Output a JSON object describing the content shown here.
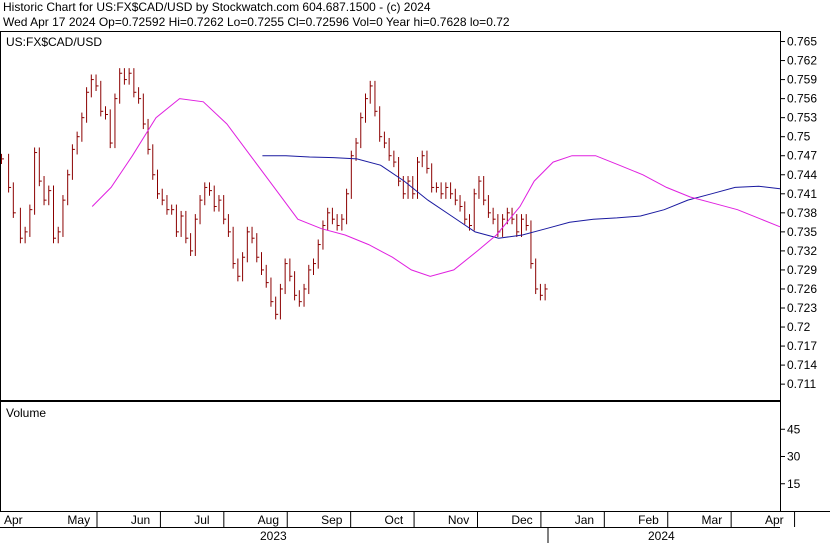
{
  "header": {
    "line1": "Historic Chart for US:FX$CAD/USD by Stockwatch.com 604.687.1500 - (c) 2024",
    "line2": "Wed Apr 17 2024  Op=0.72592  Hi=0.7262  Lo=0.7255  Cl=0.72596  Vol=0  Year hi=0.7628  lo=0.72"
  },
  "chart_data": {
    "type": "ohlc",
    "title": "US:FX$CAD/USD",
    "symbol_label": "US:FX$CAD/USD",
    "volume_label": "Volume",
    "price_ticks": [
      "0.765",
      "0.762",
      "0.759",
      "0.756",
      "0.753",
      "0.75",
      "0.747",
      "0.744",
      "0.741",
      "0.738",
      "0.735",
      "0.732",
      "0.729",
      "0.726",
      "0.723",
      "0.72",
      "0.717",
      "0.714",
      "0.711"
    ],
    "volume_ticks": [
      "45",
      "30",
      "15"
    ],
    "month_labels": [
      "Apr",
      "May",
      "Jun",
      "Jul",
      "Aug",
      "Sep",
      "Oct",
      "Nov",
      "Dec",
      "Jan",
      "Feb",
      "Mar",
      "Apr"
    ],
    "year_labels": [
      "2023",
      "2024"
    ],
    "ylim": [
      0.7085,
      0.7665
    ],
    "volume_ylim": [
      0,
      60
    ],
    "grid": false,
    "colors": {
      "bars": "#8b0000",
      "short_ma": "#e020e0",
      "long_ma": "#1a1aa0",
      "axis": "#000000"
    },
    "price_series": [
      {
        "x": 0,
        "c": 0.7465
      },
      {
        "x": 3,
        "c": 0.742
      },
      {
        "x": 5,
        "c": 0.738
      },
      {
        "x": 8,
        "c": 0.734
      },
      {
        "x": 10,
        "c": 0.735
      },
      {
        "x": 12,
        "c": 0.7385
      },
      {
        "x": 14,
        "c": 0.7475
      },
      {
        "x": 16,
        "c": 0.743
      },
      {
        "x": 18,
        "c": 0.74
      },
      {
        "x": 20,
        "c": 0.7415
      },
      {
        "x": 22,
        "c": 0.734
      },
      {
        "x": 24,
        "c": 0.735
      },
      {
        "x": 26,
        "c": 0.74
      },
      {
        "x": 28,
        "c": 0.744
      },
      {
        "x": 30,
        "c": 0.748
      },
      {
        "x": 32,
        "c": 0.75
      },
      {
        "x": 34,
        "c": 0.753
      },
      {
        "x": 36,
        "c": 0.757
      },
      {
        "x": 38,
        "c": 0.759
      },
      {
        "x": 40,
        "c": 0.758
      },
      {
        "x": 42,
        "c": 0.754
      },
      {
        "x": 44,
        "c": 0.7535
      },
      {
        "x": 46,
        "c": 0.749
      },
      {
        "x": 48,
        "c": 0.756
      },
      {
        "x": 50,
        "c": 0.76
      },
      {
        "x": 52,
        "c": 0.759
      },
      {
        "x": 54,
        "c": 0.76
      },
      {
        "x": 56,
        "c": 0.757
      },
      {
        "x": 58,
        "c": 0.756
      },
      {
        "x": 60,
        "c": 0.752
      },
      {
        "x": 62,
        "c": 0.748
      },
      {
        "x": 64,
        "c": 0.744
      },
      {
        "x": 66,
        "c": 0.741
      },
      {
        "x": 68,
        "c": 0.74
      },
      {
        "x": 70,
        "c": 0.7385
      },
      {
        "x": 72,
        "c": 0.7385
      },
      {
        "x": 74,
        "c": 0.735
      },
      {
        "x": 76,
        "c": 0.7375
      },
      {
        "x": 78,
        "c": 0.734
      },
      {
        "x": 80,
        "c": 0.732
      },
      {
        "x": 82,
        "c": 0.737
      },
      {
        "x": 84,
        "c": 0.74
      },
      {
        "x": 86,
        "c": 0.742
      },
      {
        "x": 88,
        "c": 0.7415
      },
      {
        "x": 90,
        "c": 0.739
      },
      {
        "x": 92,
        "c": 0.74
      },
      {
        "x": 94,
        "c": 0.737
      },
      {
        "x": 96,
        "c": 0.735
      },
      {
        "x": 98,
        "c": 0.73
      },
      {
        "x": 100,
        "c": 0.728
      },
      {
        "x": 102,
        "c": 0.731
      },
      {
        "x": 104,
        "c": 0.735
      },
      {
        "x": 106,
        "c": 0.734
      },
      {
        "x": 108,
        "c": 0.731
      },
      {
        "x": 110,
        "c": 0.729
      },
      {
        "x": 112,
        "c": 0.727
      },
      {
        "x": 114,
        "c": 0.724
      },
      {
        "x": 116,
        "c": 0.722
      },
      {
        "x": 118,
        "c": 0.726
      },
      {
        "x": 120,
        "c": 0.73
      },
      {
        "x": 122,
        "c": 0.728
      },
      {
        "x": 124,
        "c": 0.725
      },
      {
        "x": 126,
        "c": 0.724
      },
      {
        "x": 128,
        "c": 0.726
      },
      {
        "x": 130,
        "c": 0.729
      },
      {
        "x": 132,
        "c": 0.73
      },
      {
        "x": 134,
        "c": 0.733
      },
      {
        "x": 136,
        "c": 0.736
      },
      {
        "x": 138,
        "c": 0.738
      },
      {
        "x": 140,
        "c": 0.737
      },
      {
        "x": 142,
        "c": 0.736
      },
      {
        "x": 144,
        "c": 0.737
      },
      {
        "x": 146,
        "c": 0.741
      },
      {
        "x": 148,
        "c": 0.747
      },
      {
        "x": 150,
        "c": 0.749
      },
      {
        "x": 152,
        "c": 0.753
      },
      {
        "x": 154,
        "c": 0.756
      },
      {
        "x": 156,
        "c": 0.758
      },
      {
        "x": 158,
        "c": 0.754
      },
      {
        "x": 160,
        "c": 0.75
      },
      {
        "x": 162,
        "c": 0.749
      },
      {
        "x": 164,
        "c": 0.747
      },
      {
        "x": 166,
        "c": 0.746
      },
      {
        "x": 168,
        "c": 0.743
      },
      {
        "x": 170,
        "c": 0.741
      },
      {
        "x": 172,
        "c": 0.743
      },
      {
        "x": 174,
        "c": 0.741
      },
      {
        "x": 176,
        "c": 0.746
      },
      {
        "x": 178,
        "c": 0.747
      },
      {
        "x": 180,
        "c": 0.745
      },
      {
        "x": 182,
        "c": 0.742
      },
      {
        "x": 184,
        "c": 0.742
      },
      {
        "x": 186,
        "c": 0.741
      },
      {
        "x": 188,
        "c": 0.742
      },
      {
        "x": 190,
        "c": 0.741
      },
      {
        "x": 192,
        "c": 0.74
      },
      {
        "x": 194,
        "c": 0.739
      },
      {
        "x": 196,
        "c": 0.737
      },
      {
        "x": 198,
        "c": 0.736
      },
      {
        "x": 200,
        "c": 0.741
      },
      {
        "x": 202,
        "c": 0.743
      },
      {
        "x": 204,
        "c": 0.74
      },
      {
        "x": 206,
        "c": 0.738
      },
      {
        "x": 208,
        "c": 0.737
      },
      {
        "x": 210,
        "c": 0.735
      },
      {
        "x": 212,
        "c": 0.737
      },
      {
        "x": 214,
        "c": 0.738
      },
      {
        "x": 216,
        "c": 0.737
      },
      {
        "x": 218,
        "c": 0.735
      },
      {
        "x": 220,
        "c": 0.737
      },
      {
        "x": 222,
        "c": 0.736
      },
      {
        "x": 224,
        "c": 0.73
      },
      {
        "x": 226,
        "c": 0.726
      },
      {
        "x": 228,
        "c": 0.725
      },
      {
        "x": 230,
        "c": 0.726
      }
    ],
    "moving_average_short": [
      {
        "x": 39,
        "v": 0.739
      },
      {
        "x": 47,
        "v": 0.742
      },
      {
        "x": 56,
        "v": 0.747
      },
      {
        "x": 66,
        "v": 0.753
      },
      {
        "x": 76,
        "v": 0.756
      },
      {
        "x": 86,
        "v": 0.7555
      },
      {
        "x": 96,
        "v": 0.752
      },
      {
        "x": 106,
        "v": 0.747
      },
      {
        "x": 116,
        "v": 0.742
      },
      {
        "x": 126,
        "v": 0.737
      },
      {
        "x": 136,
        "v": 0.7355
      },
      {
        "x": 146,
        "v": 0.7345
      },
      {
        "x": 156,
        "v": 0.733
      },
      {
        "x": 166,
        "v": 0.731
      },
      {
        "x": 174,
        "v": 0.729
      },
      {
        "x": 182,
        "v": 0.728
      },
      {
        "x": 192,
        "v": 0.729
      },
      {
        "x": 202,
        "v": 0.732
      },
      {
        "x": 210,
        "v": 0.7345
      },
      {
        "x": 220,
        "v": 0.739
      },
      {
        "x": 226,
        "v": 0.743
      },
      {
        "x": 234,
        "v": 0.746
      },
      {
        "x": 242,
        "v": 0.747
      },
      {
        "x": 252,
        "v": 0.747
      },
      {
        "x": 262,
        "v": 0.7455
      },
      {
        "x": 272,
        "v": 0.744
      },
      {
        "x": 282,
        "v": 0.742
      },
      {
        "x": 292,
        "v": 0.7405
      },
      {
        "x": 302,
        "v": 0.7395
      },
      {
        "x": 312,
        "v": 0.7385
      },
      {
        "x": 322,
        "v": 0.737
      },
      {
        "x": 330,
        "v": 0.7358
      }
    ],
    "moving_average_long": [
      {
        "x": 111,
        "v": 0.747
      },
      {
        "x": 121,
        "v": 0.747
      },
      {
        "x": 131,
        "v": 0.7468
      },
      {
        "x": 141,
        "v": 0.7467
      },
      {
        "x": 151,
        "v": 0.7465
      },
      {
        "x": 161,
        "v": 0.7455
      },
      {
        "x": 171,
        "v": 0.743
      },
      {
        "x": 181,
        "v": 0.74
      },
      {
        "x": 191,
        "v": 0.7375
      },
      {
        "x": 201,
        "v": 0.735
      },
      {
        "x": 211,
        "v": 0.734
      },
      {
        "x": 221,
        "v": 0.7345
      },
      {
        "x": 231,
        "v": 0.7355
      },
      {
        "x": 241,
        "v": 0.7365
      },
      {
        "x": 251,
        "v": 0.737
      },
      {
        "x": 261,
        "v": 0.7372
      },
      {
        "x": 271,
        "v": 0.7375
      },
      {
        "x": 281,
        "v": 0.7385
      },
      {
        "x": 291,
        "v": 0.74
      },
      {
        "x": 301,
        "v": 0.741
      },
      {
        "x": 311,
        "v": 0.742
      },
      {
        "x": 321,
        "v": 0.7422
      },
      {
        "x": 330,
        "v": 0.7418
      }
    ]
  }
}
